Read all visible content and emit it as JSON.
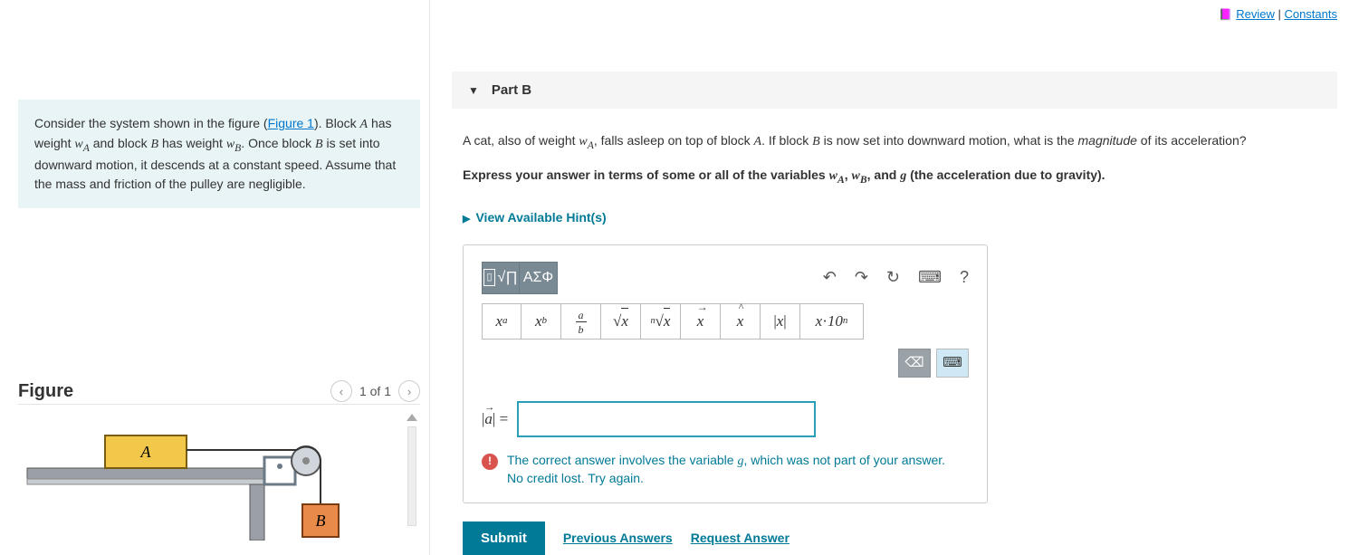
{
  "topLinks": {
    "review": "Review",
    "constants": "Constants",
    "separator": " | "
  },
  "intro": {
    "prefix": "Consider the system shown in the figure (",
    "figureLinkText": "Figure 1",
    "afterLink": "). Block ",
    "A": "A",
    "line1b": " has weight ",
    "wA": "w",
    "subA": "A",
    "line1c": " and block ",
    "B": "B",
    "line1d": " has weight ",
    "wB": "w",
    "subB": "B",
    "line1e": ". Once block ",
    "line1f": " is set into downward motion, it descends at a constant speed. Assume that the mass and friction of the pulley are negligible."
  },
  "figure": {
    "heading": "Figure",
    "pagerText": "1 of 1",
    "labelA": "A",
    "labelB": "B"
  },
  "part": {
    "title": "Part B"
  },
  "question": {
    "p1a": "A cat, also of weight ",
    "p1b": ", falls asleep on top of block ",
    "p1c": ". If block ",
    "p1d": " is now set into downward motion, what is the ",
    "magnitude": "magnitude",
    "p1e": " of its acceleration?",
    "instrA": "Express your answer in terms of some or all of the variables ",
    "instrComma": ", ",
    "instrAnd": ", and ",
    "gVar": "g",
    "instrB": " (the acceleration due to gravity).",
    "hints": "View Available Hint(s)"
  },
  "toolbar": {
    "templates_glyph": "√∏",
    "greek_glyph": "ΑΣΦ",
    "undo_glyph": "↶",
    "redo_glyph": "↷",
    "reset_glyph": "↻",
    "keyboard_glyph": "⌨",
    "help_glyph": "?",
    "tb2": {
      "sup": "xᵃ",
      "sub": "xᵇ",
      "frac": "a⁄b",
      "sqrt": "√x",
      "nroot": "ⁿ√x",
      "vec": "x⃗",
      "hat": "x̂",
      "abs": "|x|",
      "sci": "x·10ⁿ"
    },
    "bksp_glyph": "⌫",
    "kbd2_glyph": "⌨"
  },
  "answer": {
    "labelA": "|a⃗|",
    "labelEq": " = "
  },
  "feedback": {
    "line1a": "The correct answer involves the variable ",
    "line1b": ", which was not part of your answer.",
    "line2": "No credit lost. Try again."
  },
  "actions": {
    "submit": "Submit",
    "prev": "Previous Answers",
    "request": "Request Answer"
  }
}
